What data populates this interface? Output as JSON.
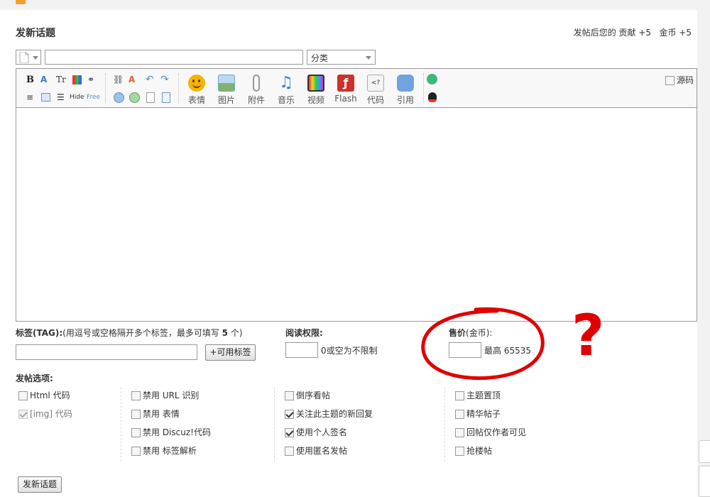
{
  "header": {
    "title": "发新话题",
    "credit_prefix": "发帖后您的",
    "credit_items": "贡献 +5   金币 +5"
  },
  "subject": {
    "category_select": "分类",
    "subject_value": ""
  },
  "editor": {
    "source_label": "源码",
    "small_tools_row1": [
      "bold",
      "font",
      "text-size",
      "color",
      "link",
      "unlink",
      "clear-format",
      "undo",
      "redo"
    ],
    "small_tools_row2": [
      "align",
      "table",
      "list",
      "Hide",
      "Free",
      "media-1",
      "media-2",
      "page",
      "page-break"
    ],
    "hide_label": "Hide",
    "free_label": "Free",
    "big_tools": [
      {
        "label": "表情",
        "icon": "smiley-icon",
        "color": "#f5b400"
      },
      {
        "label": "图片",
        "icon": "image-icon",
        "color": "#6ea4d8"
      },
      {
        "label": "附件",
        "icon": "attachment-icon",
        "color": "#9a9a9a"
      },
      {
        "label": "音乐",
        "icon": "music-icon",
        "color": "#2f7fe0"
      },
      {
        "label": "视频",
        "icon": "video-icon",
        "color": "#8a3a8a"
      },
      {
        "label": "Flash",
        "icon": "flash-icon",
        "color": "#d0302a"
      },
      {
        "label": "代码",
        "icon": "code-icon",
        "color": "#c8c8c8"
      },
      {
        "label": "引用",
        "icon": "quote-icon",
        "color": "#6fa4e0"
      }
    ],
    "content": ""
  },
  "tags": {
    "label": "标签(TAG):",
    "hint_prefix": "(用逗号或空格隔开多个标签，最多可填写 ",
    "hint_count": "5",
    "hint_suffix": " 个)",
    "value": "",
    "available_button": "+可用标签"
  },
  "read_perm": {
    "label": "阅读权限:",
    "value": "",
    "hint": "0或空为不限制"
  },
  "price": {
    "label": "售价",
    "unit": "(金币):",
    "value": "",
    "max_label": "最高 65535"
  },
  "options": {
    "label": "发帖选项:",
    "columns": [
      [
        {
          "label": "Html 代码",
          "checked": false,
          "disabled": false
        },
        {
          "label": "[img] 代码",
          "checked": true,
          "disabled": true
        }
      ],
      [
        {
          "label": "禁用 URL 识别",
          "checked": false,
          "disabled": false
        },
        {
          "label": "禁用 表情",
          "checked": false,
          "disabled": false
        },
        {
          "label": "禁用 Discuz!代码",
          "checked": false,
          "disabled": false
        },
        {
          "label": "禁用 标签解析",
          "checked": false,
          "disabled": false
        }
      ],
      [
        {
          "label": "倒序看帖",
          "checked": false,
          "disabled": false
        },
        {
          "label": "关注此主题的新回复",
          "checked": true,
          "disabled": false
        },
        {
          "label": "使用个人签名",
          "checked": true,
          "disabled": false
        },
        {
          "label": "使用匿名发帖",
          "checked": false,
          "disabled": false
        }
      ],
      [
        {
          "label": "主题置顶",
          "checked": false,
          "disabled": false
        },
        {
          "label": "精华帖子",
          "checked": false,
          "disabled": false
        },
        {
          "label": "回帖仅作者可见",
          "checked": false,
          "disabled": false
        },
        {
          "label": "抢楼帖",
          "checked": false,
          "disabled": false
        }
      ]
    ]
  },
  "submit_button": "发新话题",
  "annotation": {
    "question_mark": "?",
    "color": "#e00000"
  }
}
